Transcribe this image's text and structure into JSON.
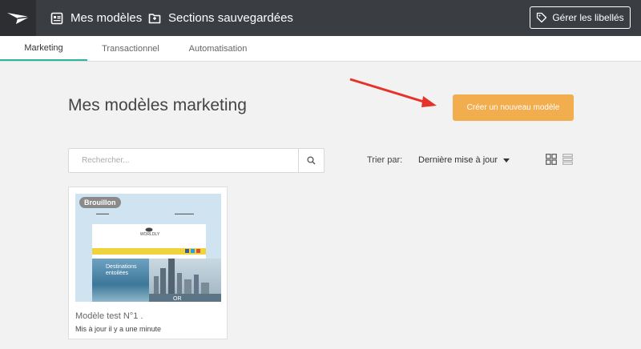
{
  "topbar": {
    "nav": [
      {
        "label": "Mes modèles",
        "icon": "templates-icon"
      },
      {
        "label": "Sections sauvegardées",
        "icon": "folder-icon"
      }
    ],
    "labels_button": "Gérer les libellés"
  },
  "tabs": [
    {
      "label": "Marketing",
      "active": true
    },
    {
      "label": "Transactionnel",
      "active": false
    },
    {
      "label": "Automatisation",
      "active": false
    }
  ],
  "main": {
    "title": "Mes modèles marketing",
    "create_button": "Créer un nouveau modèle",
    "search_placeholder": "Rechercher...",
    "sort_label": "Trier par:",
    "sort_value": "Dernière mise à jour"
  },
  "templates": [
    {
      "badge": "Brouillon",
      "name": "Modèle test N°1 .",
      "updated": "Mis à jour il y a une minute",
      "thumb": {
        "brand": "WORLDLY",
        "hero_text": "Destinations entoilées",
        "or_text": "OR"
      }
    }
  ],
  "colors": {
    "topbar": "#3a3d42",
    "accent_tab": "#2bb3a3",
    "create_button": "#f2ad4e",
    "arrow": "#e53329"
  }
}
